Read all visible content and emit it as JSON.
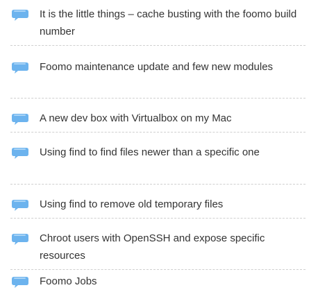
{
  "posts": [
    {
      "title": "It is the little things – cache busting with the foomo build number"
    },
    {
      "title": "Foomo maintenance update and few new modules"
    },
    {
      "title": "A new dev box with Virtualbox on my Mac"
    },
    {
      "title": "Using find to find files newer than a specific one"
    },
    {
      "title": "Using find to remove old temporary files"
    },
    {
      "title": "Chroot users with OpenSSH and expose specific resources"
    },
    {
      "title": "Foomo Jobs"
    }
  ],
  "colors": {
    "bubble": "#6cb3ee",
    "text": "#333333",
    "divider": "#cfcfcf"
  }
}
